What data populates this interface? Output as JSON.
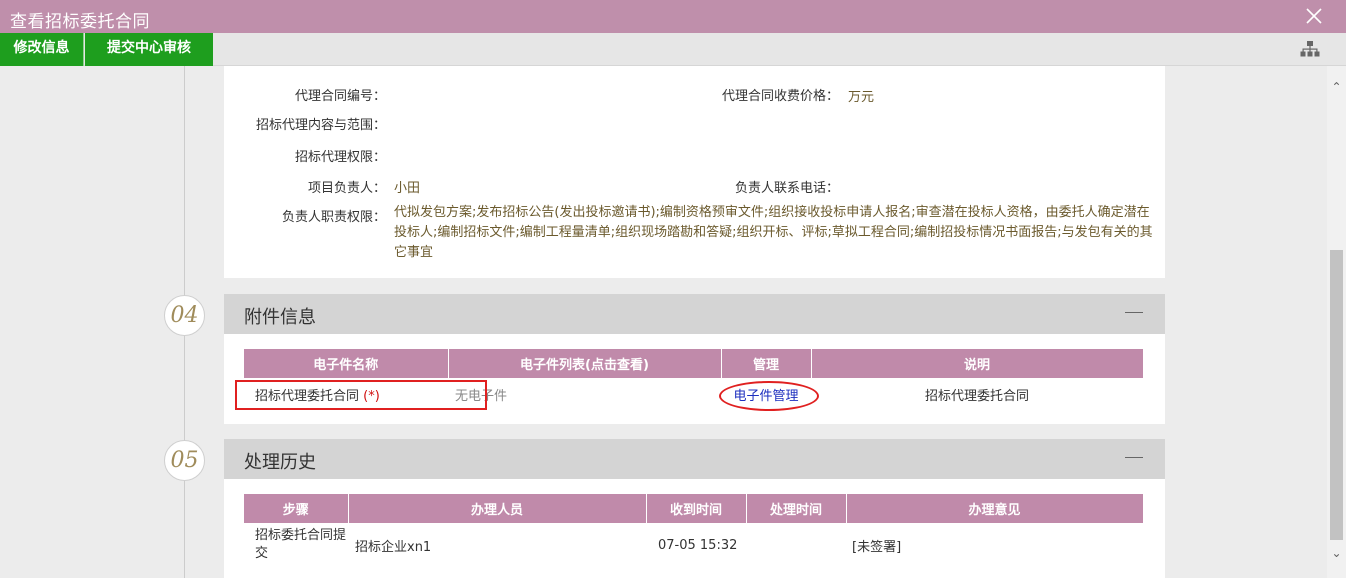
{
  "window": {
    "title": "查看招标委托合同",
    "close_icon": "close-icon"
  },
  "toolbar": {
    "edit_label": "修改信息",
    "submit_label": "提交中心审核",
    "org_icon": "sitemap-icon"
  },
  "contract_info": {
    "fields": {
      "contract_no_label": "代理合同编号：",
      "contract_no_value": "",
      "fee_label": "代理合同收费价格：",
      "fee_value": "万元",
      "scope_label": "招标代理内容与范围：",
      "scope_value": "",
      "authority_label": "招标代理权限：",
      "authority_value": "",
      "manager_label": "项目负责人：",
      "manager_value": "小田",
      "phone_label": "负责人联系电话：",
      "phone_value": "",
      "duty_label": "负责人职责权限：",
      "duty_value": "代拟发包方案;发布招标公告(发出投标邀请书);编制资格预审文件;组织接收投标申请人报名;审查潜在投标人资格，由委托人确定潜在投标人;编制招标文件;编制工程量清单;组织现场踏勘和答疑;组织开标、评标;草拟工程合同;编制招投标情况书面报告;与发包有关的其它事宜"
    }
  },
  "sections": {
    "attachments": {
      "number": "04",
      "title": "附件信息"
    },
    "history": {
      "number": "05",
      "title": "处理历史"
    }
  },
  "attachments_table": {
    "headers": [
      "电子件名称",
      "电子件列表(点击查看)",
      "管理",
      "说明"
    ],
    "rows": [
      {
        "name": "招标代理委托合同",
        "required_mark": "(*)",
        "files": "无电子件",
        "manage": "电子件管理",
        "note": "招标代理委托合同"
      }
    ]
  },
  "history_table": {
    "headers": [
      "步骤",
      "办理人员",
      "收到时间",
      "处理时间",
      "办理意见"
    ],
    "rows": [
      {
        "step": "招标委托合同提交",
        "handler": "招标企业xn1",
        "received": "07-05 15:32",
        "processed": "",
        "opinion": "[未签署]"
      }
    ]
  },
  "colors": {
    "title_bar": "#bf8fab",
    "action_green": "#1e9e1e",
    "table_header": "#c08aaa",
    "highlight_red": "#e02020",
    "link_blue": "#1d2fbf"
  }
}
